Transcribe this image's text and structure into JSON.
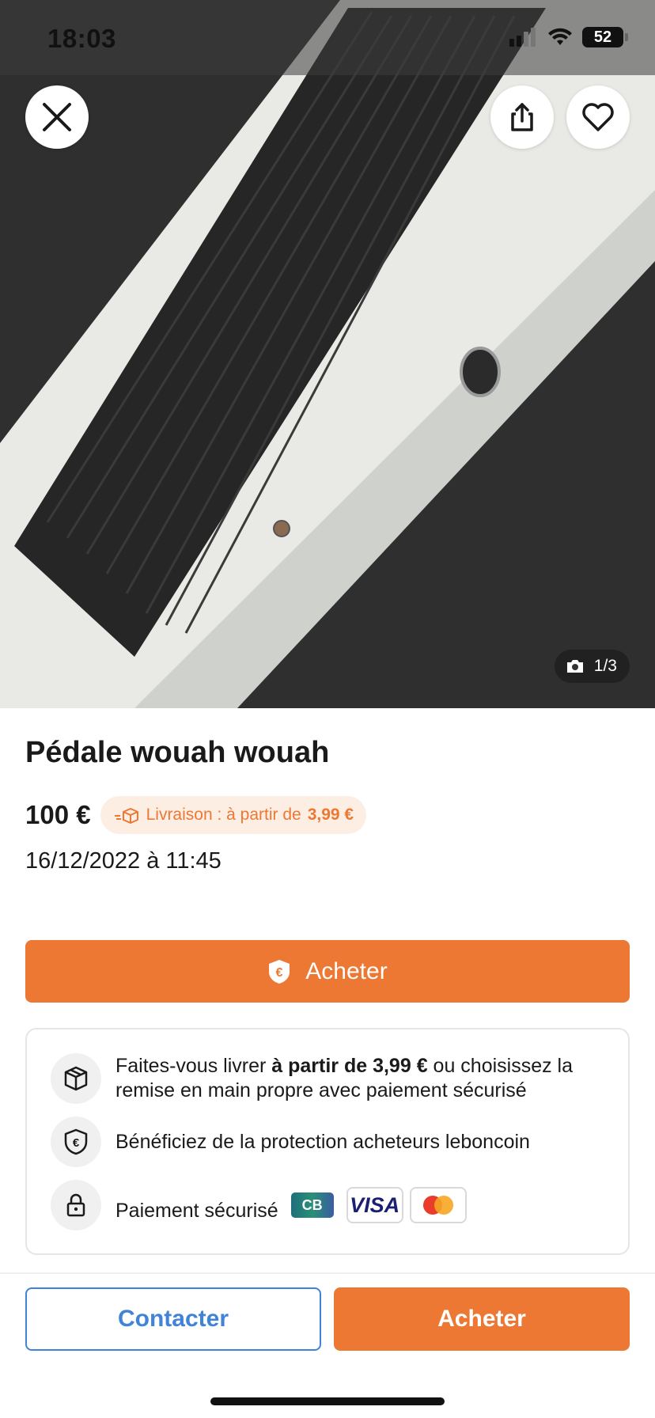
{
  "status_bar": {
    "time": "18:03",
    "battery": "52",
    "icons": [
      "signal-icon",
      "wifi-icon",
      "battery-icon"
    ]
  },
  "photo": {
    "counter": "1/3",
    "icons": {
      "close": "close-icon",
      "share": "share-icon",
      "favorite": "heart-icon",
      "camera": "camera-icon"
    }
  },
  "listing": {
    "title": "Pédale wouah wouah",
    "price": "100 €",
    "delivery_prefix": "Livraison : à partir de",
    "delivery_price": "3,99 €",
    "date": "16/12/2022 à 11:45"
  },
  "buy_main": {
    "label": "Acheter",
    "icon": "euro-shield-icon"
  },
  "info": {
    "row1_pre": "Faites-vous livrer ",
    "row1_bold": "à partir de 3,99 €",
    "row1_post": " ou choisissez la remise en main propre avec paiement sécurisé",
    "row2": "Bénéficiez de la protection acheteurs leboncoin",
    "row3": "Paiement sécurisé",
    "cards": {
      "cb": "CB",
      "visa": "VISA",
      "mastercard": "mastercard-icon"
    }
  },
  "footer": {
    "contact_label": "Contacter",
    "buy_label": "Acheter"
  },
  "colors": {
    "accent": "#ec7833",
    "link_blue": "#4183d7",
    "badge_bg": "#fdeee4"
  }
}
